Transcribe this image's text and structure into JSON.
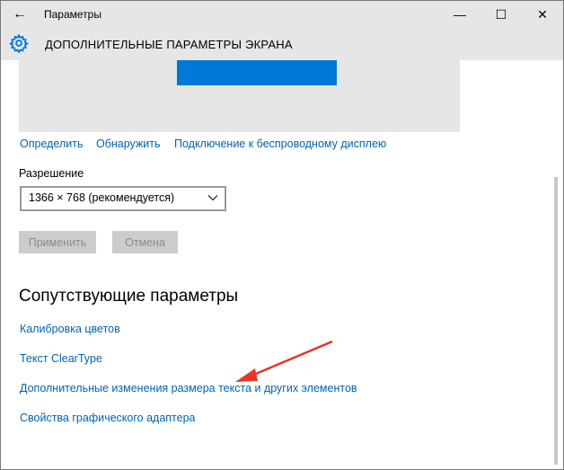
{
  "window": {
    "title": "Параметры",
    "back_glyph": "←",
    "minimize_glyph": "—",
    "maximize_glyph": "☐",
    "close_glyph": "✕"
  },
  "header": {
    "title": "ДОПОЛНИТЕЛЬНЫЕ ПАРАМЕТРЫ ЭКРАНА",
    "icon": "gear-icon"
  },
  "display": {
    "links": {
      "identify": "Определить",
      "detect": "Обнаружить",
      "wireless": "Подключение к беспроводному дисплею"
    },
    "resolution_label": "Разрешение",
    "resolution_value": "1366 × 768 (рекомендуется)",
    "apply_label": "Применить",
    "cancel_label": "Отмена"
  },
  "related": {
    "title": "Сопутствующие параметры",
    "links": [
      "Калибровка цветов",
      "Текст ClearType",
      "Дополнительные изменения размера текста и других элементов",
      "Свойства графического адаптера"
    ]
  },
  "colors": {
    "accent": "#0078d7",
    "link": "#0063b1",
    "header_bg": "#e6e6e6",
    "annotation_arrow": "#e8342a"
  }
}
